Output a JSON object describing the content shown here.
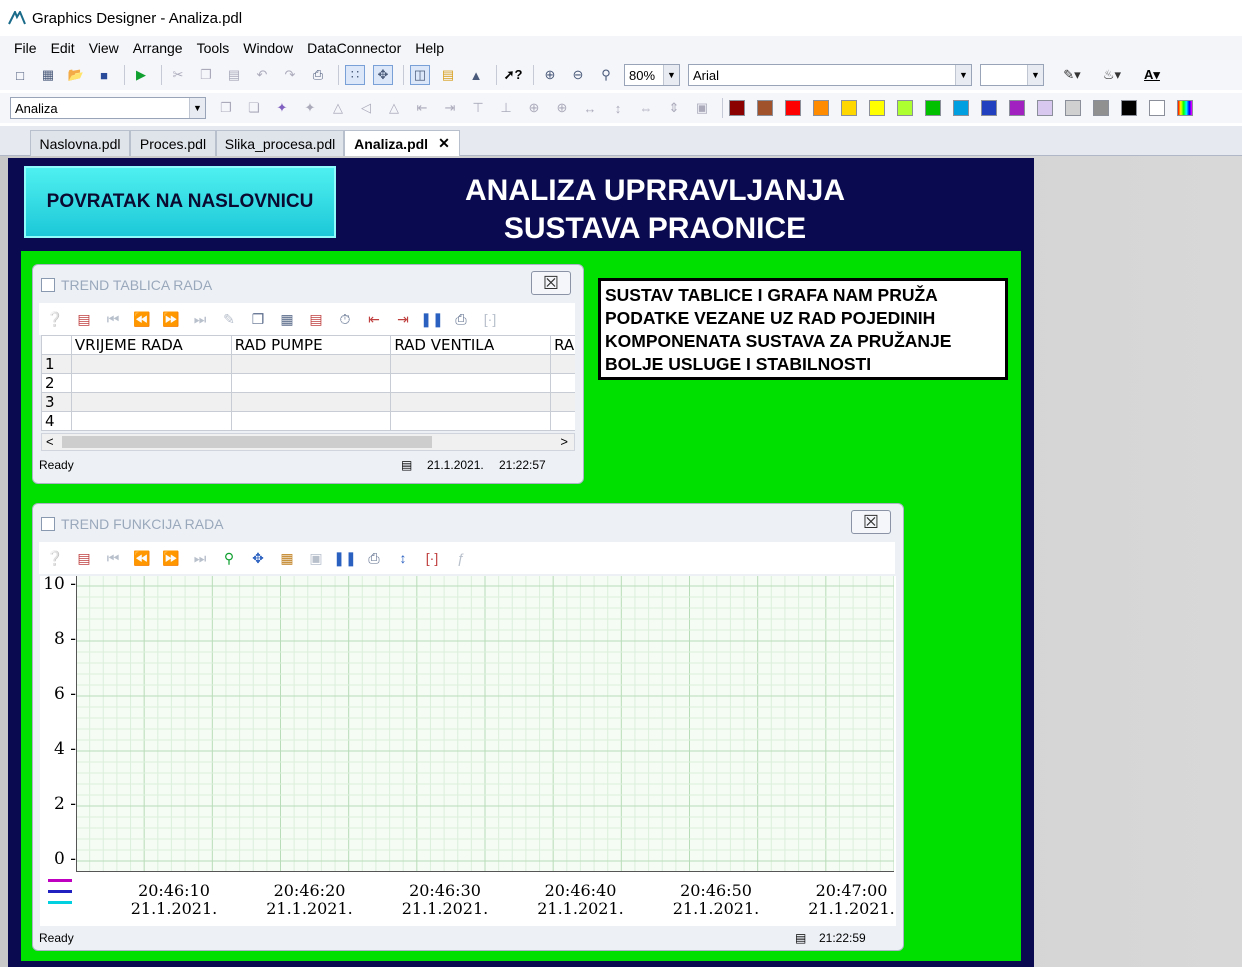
{
  "window": {
    "title": "Graphics Designer - Analiza.pdl"
  },
  "menu": [
    "File",
    "Edit",
    "View",
    "Arrange",
    "Tools",
    "Window",
    "DataConnector",
    "Help"
  ],
  "toolbar": {
    "zoom": "80%",
    "font": "Arial",
    "layer_combo": "Analiza",
    "colors": [
      "#8b0000",
      "#a0522d",
      "#ff0000",
      "#ff8c00",
      "#ffd700",
      "#ffff00",
      "#adff2f",
      "#00c000",
      "#00a0e0",
      "#2040c0",
      "#a020c0",
      "#d8c8f0",
      "#d0d0d0",
      "#909090",
      "#000000",
      "#ffffff"
    ]
  },
  "tabs": [
    "Naslovna.pdl",
    "Proces.pdl",
    "Slika_procesa.pdl",
    "Analiza.pdl"
  ],
  "active_tab": "Analiza.pdl",
  "page": {
    "back_button": "POVRATAK NA NASLOVNICU",
    "heading_line1": "ANALIZA UPRRAVLJANJA",
    "heading_line2": "SUSTAVA PRAONICE",
    "info_text": "SUSTAV TABLICE I GRAFA NAM PRUŽA PODATKE VEZANE UZ RAD POJEDINIH KOMPONENATA SUSTAVA ZA PRUŽANJE BOLJE USLUGE I STABILNOSTI"
  },
  "table_window": {
    "title": "TREND TABLICA RADA",
    "columns": [
      "VRIJEME RADA",
      "RAD PUMPE",
      "RAD VENTILA",
      "RA"
    ],
    "rows": [
      "1",
      "2",
      "3",
      "4"
    ],
    "status": "Ready",
    "date": "21.1.2021.",
    "time": "21:22:57"
  },
  "trend_window": {
    "title": "TREND FUNKCIJA RADA",
    "status": "Ready",
    "time": "21:22:59"
  },
  "chart_data": {
    "type": "line",
    "y_ticks": [
      "10",
      "8",
      "6",
      "4",
      "2",
      "0"
    ],
    "ylim": [
      0,
      10
    ],
    "x_ticks": [
      {
        "time": "20:46:10",
        "date": "21.1.2021."
      },
      {
        "time": "20:46:20",
        "date": "21.1.2021."
      },
      {
        "time": "20:46:30",
        "date": "21.1.2021."
      },
      {
        "time": "20:46:40",
        "date": "21.1.2021."
      },
      {
        "time": "20:46:50",
        "date": "21.1.2021."
      },
      {
        "time": "20:47:00",
        "date": "21.1.2021."
      }
    ],
    "series_colors": [
      "#c000c0",
      "#2020c0",
      "#00d0e0"
    ],
    "grid": true
  }
}
